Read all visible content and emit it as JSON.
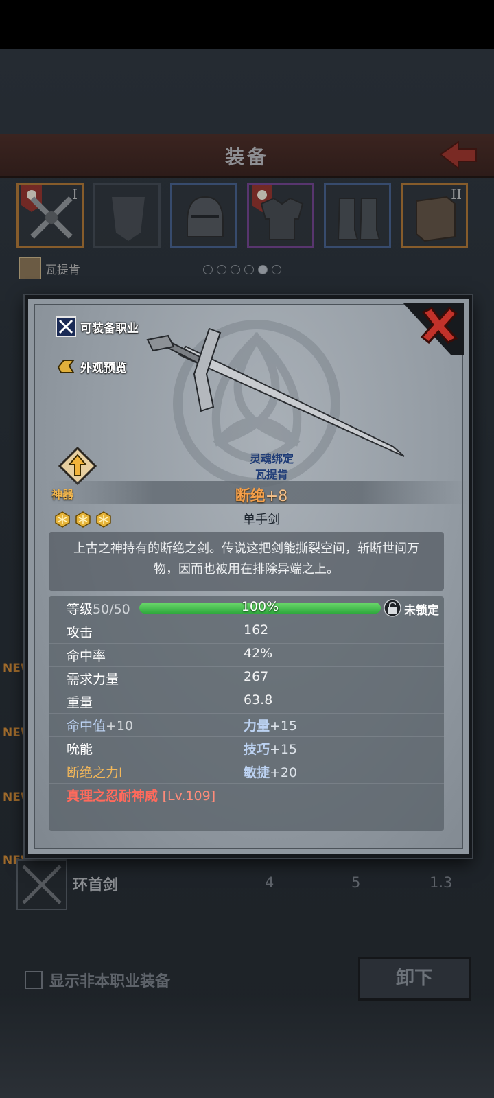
{
  "header": {
    "title": "装备"
  },
  "slots": [
    {
      "name": "weapon",
      "tier": "I"
    },
    {
      "name": "shield",
      "tier": ""
    },
    {
      "name": "helmet",
      "tier": ""
    },
    {
      "name": "armor",
      "tier": ""
    },
    {
      "name": "boots",
      "tier": ""
    },
    {
      "name": "book",
      "tier": "II"
    }
  ],
  "character": {
    "name": "瓦提肯"
  },
  "list": {
    "new_label": "NEW",
    "row": {
      "name": "环首剑",
      "v1": "4",
      "v2": "5",
      "v3": "1.3"
    }
  },
  "footer": {
    "checkbox_label": "显示非本职业装备",
    "unequip_label": "卸下"
  },
  "modal": {
    "options": {
      "equippable_class": "可装备职业",
      "appearance_preview": "外观预览"
    },
    "bind": {
      "label": "灵魂绑定",
      "owner": "瓦提肯"
    },
    "rarity": "神器",
    "item_name": "断绝",
    "enhance": "+8",
    "stars": 3,
    "item_type": "单手剑",
    "description": "上古之神持有的断绝之剑。传说这把剑能撕裂空间，斩断世间万物，因而也被用在排除异端之上。",
    "level": {
      "label": "等级",
      "value": "50/50",
      "percent_text": "100%",
      "percent": 100,
      "lock_text": "未锁定"
    },
    "stats": [
      {
        "key": "攻击",
        "value": "162"
      },
      {
        "key": "命中率",
        "value": "42%"
      },
      {
        "key": "需求力量",
        "value": "267"
      },
      {
        "key": "重量",
        "value": "63.8"
      }
    ],
    "bonus": [
      {
        "left_key": "命中值",
        "left_val": "+10",
        "right_key": "力量",
        "right_val": "+15"
      },
      {
        "left_key": "吮能",
        "left_val": "",
        "right_key": "技巧",
        "right_val": "+15"
      },
      {
        "left_key": "断绝之力I",
        "left_val": "",
        "right_key": "敏捷",
        "right_val": "+20"
      }
    ],
    "special": {
      "name": "真理之忍耐神威",
      "level": "[Lv.109]"
    }
  }
}
